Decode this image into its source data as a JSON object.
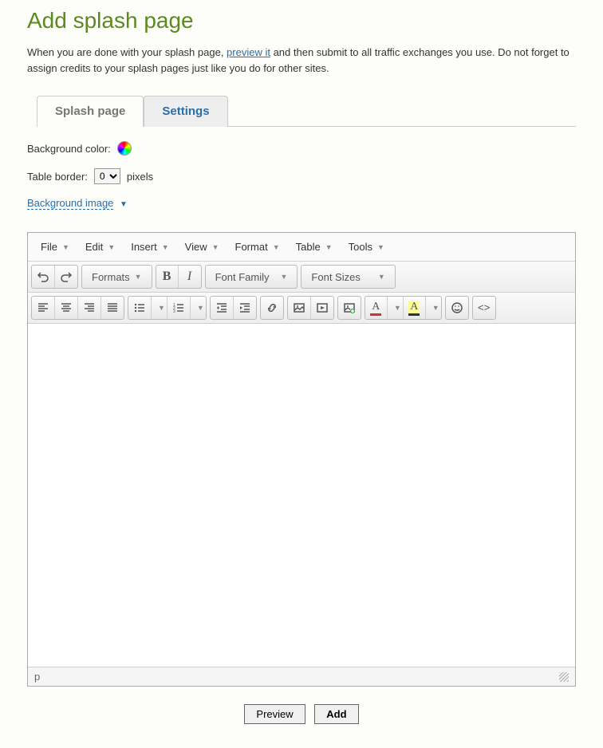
{
  "page": {
    "title": "Add splash page",
    "intro_before": "When you are done with your splash page, ",
    "intro_link": "preview it",
    "intro_after": " and then submit to all traffic exchanges you use. Do not forget to assign credits to your splash pages just like you do for other sites."
  },
  "tabs": {
    "splash": "Splash page",
    "settings": "Settings"
  },
  "fields": {
    "bg_color_label": "Background color:",
    "table_border_label": "Table border:",
    "table_border_value": "0",
    "pixels": "pixels",
    "bg_image": "Background image"
  },
  "editor": {
    "menu": {
      "file": "File",
      "edit": "Edit",
      "insert": "Insert",
      "view": "View",
      "format": "Format",
      "table": "Table",
      "tools": "Tools"
    },
    "toolbar": {
      "formats": "Formats",
      "bold": "B",
      "italic": "I",
      "font_family": "Font Family",
      "font_sizes": "Font Sizes",
      "text_color": "A",
      "bg_color": "A",
      "source": "<>"
    },
    "status_path": "p"
  },
  "buttons": {
    "preview": "Preview",
    "add": "Add"
  }
}
